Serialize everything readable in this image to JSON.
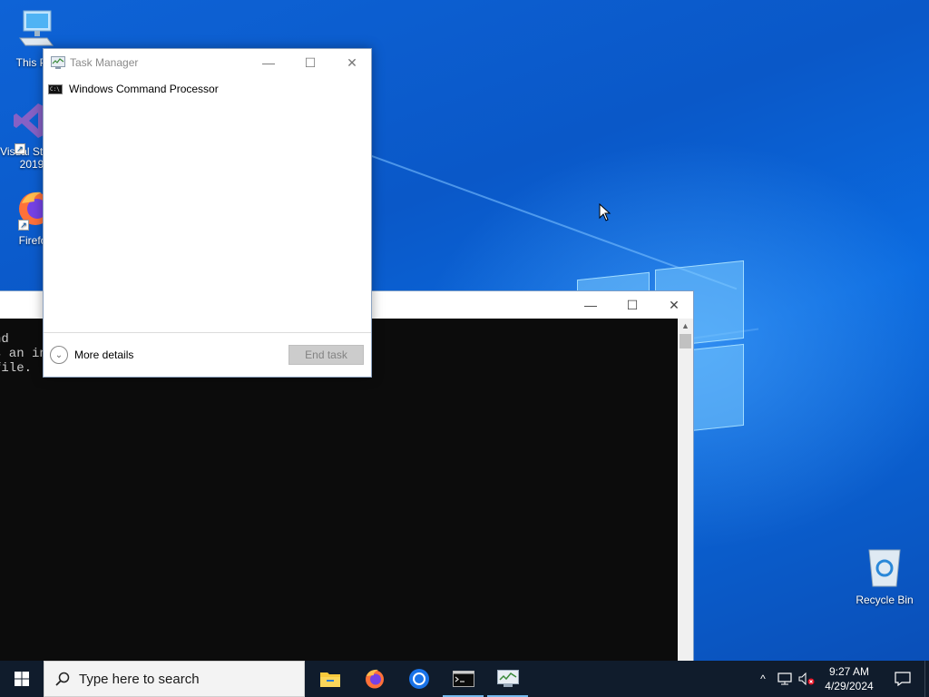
{
  "desktop": {
    "icons": [
      {
        "label": "This PC"
      },
      {
        "label": "Visual Studio 2019"
      },
      {
        "label": "Firefox"
      },
      {
        "label": "Recycle Bin"
      }
    ]
  },
  "cmd_window": {
    "console_lines": [
      "nd",
      "s an in",
      "file.",
      "."
    ]
  },
  "task_manager": {
    "title": "Task Manager",
    "processes": [
      {
        "name": "Windows Command Processor"
      }
    ],
    "more_details_label": "More details",
    "end_task_label": "End task"
  },
  "taskbar": {
    "search_placeholder": "Type here to search",
    "pinned": [
      "file-explorer-icon",
      "firefox-icon",
      "chrome-icon",
      "command-prompt-icon",
      "task-manager-icon"
    ],
    "clock_time": "9:27 AM",
    "clock_date": "4/29/2024"
  },
  "colors": {
    "taskbar": "#101c2c",
    "desktop": "#0a5fd0",
    "console_bg": "#0c0c0c",
    "accent": "#76b9ed"
  }
}
